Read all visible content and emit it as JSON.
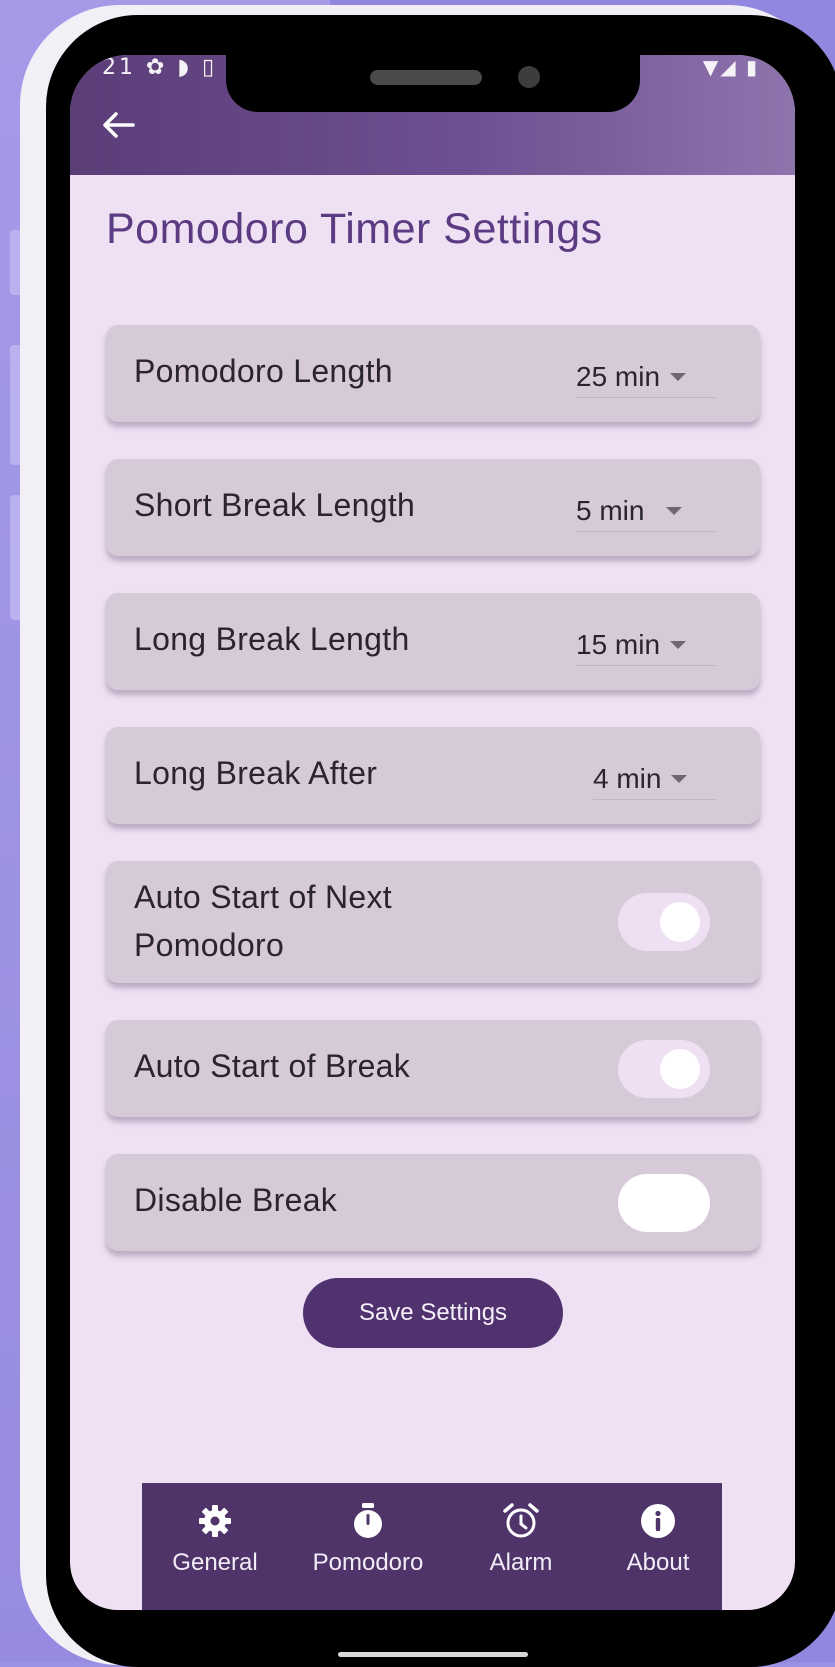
{
  "status_bar": {
    "left_text": "21 ✿ ◗ ▯",
    "right_text": "▼◢ ▮"
  },
  "header": {
    "back_icon": "arrow-left-icon"
  },
  "page": {
    "title": "Pomodoro Timer Settings"
  },
  "settings": [
    {
      "label": "Pomodoro Length",
      "type": "dropdown",
      "value": "25 min"
    },
    {
      "label": "Short Break Length",
      "type": "dropdown",
      "value": "5 min"
    },
    {
      "label": "Long Break Length",
      "type": "dropdown",
      "value": "15 min"
    },
    {
      "label": "Long Break After",
      "type": "dropdown",
      "value": "4 min"
    },
    {
      "label_line1": "Auto Start of Next",
      "label_line2": "Pomodoro",
      "type": "toggle",
      "checked": true
    },
    {
      "label": "Auto Start of Break",
      "type": "toggle",
      "checked": true
    },
    {
      "label": "Disable Break",
      "type": "toggle",
      "checked": false
    }
  ],
  "save_button": {
    "label": "Save Settings"
  },
  "bottom_nav": [
    {
      "label": "General",
      "icon": "gear-icon"
    },
    {
      "label": "Pomodoro",
      "icon": "stopwatch-icon"
    },
    {
      "label": "Alarm",
      "icon": "alarm-clock-icon"
    },
    {
      "label": "About",
      "icon": "info-icon"
    }
  ],
  "colors": {
    "background": "#9b91e4",
    "screen": "#efe0f3",
    "card": "#d6c9d8",
    "accent": "#50336e",
    "title": "#5b3b82"
  }
}
